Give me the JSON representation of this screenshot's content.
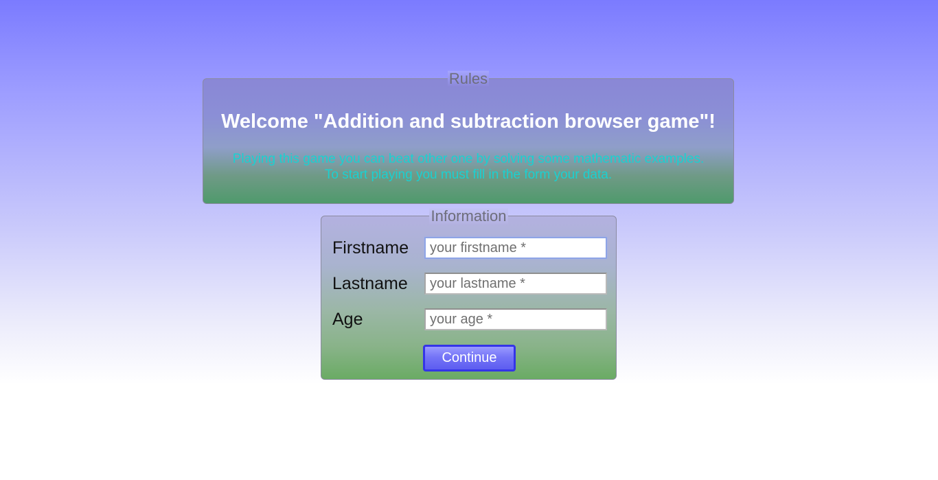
{
  "rules": {
    "legend": "Rules",
    "title": "Welcome \"Addition and subtraction browser game\"!",
    "description_lines": [
      "Playing this game you can beat other one by solving some mathematic examples.",
      "To start playing you must fill in the form your data."
    ]
  },
  "information": {
    "legend": "Information",
    "fields": [
      {
        "label": "Firstname",
        "placeholder": "your firstname *",
        "value": ""
      },
      {
        "label": "Lastname",
        "placeholder": "your lastname *",
        "value": ""
      },
      {
        "label": "Age",
        "placeholder": "your age *",
        "value": ""
      }
    ],
    "continue_label": "Continue"
  },
  "colors": {
    "description_text": "#1ad1d1",
    "button_border": "#3434e8",
    "button_fill": "#7474f7"
  }
}
